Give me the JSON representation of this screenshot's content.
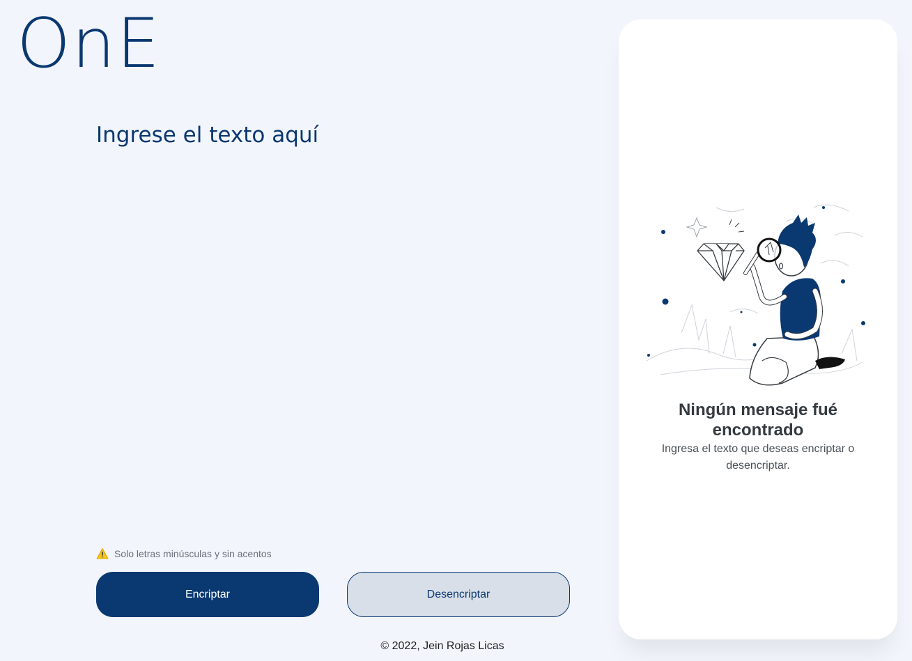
{
  "logo": {
    "text": "OnE"
  },
  "input": {
    "placeholder": "Ingrese el texto aquí",
    "value": ""
  },
  "hint": {
    "icon": "warning-icon",
    "text": "Solo letras minúsculas y sin acentos"
  },
  "buttons": {
    "encrypt_label": "Encriptar",
    "decrypt_label": "Desencriptar"
  },
  "output": {
    "illustration": "person-with-magnifying-glass",
    "title": "Ningún mensaje fué encontrado",
    "subtitle": "Ingresa el texto que deseas encriptar o desencriptar."
  },
  "footer": {
    "text": "© 2022, Jein Rojas Licas"
  },
  "colors": {
    "primary": "#0A3871",
    "background": "#F3F5FC",
    "secondary_button": "#D8DFE8",
    "warning": "#F5C518",
    "panel": "#FFFFFF"
  }
}
